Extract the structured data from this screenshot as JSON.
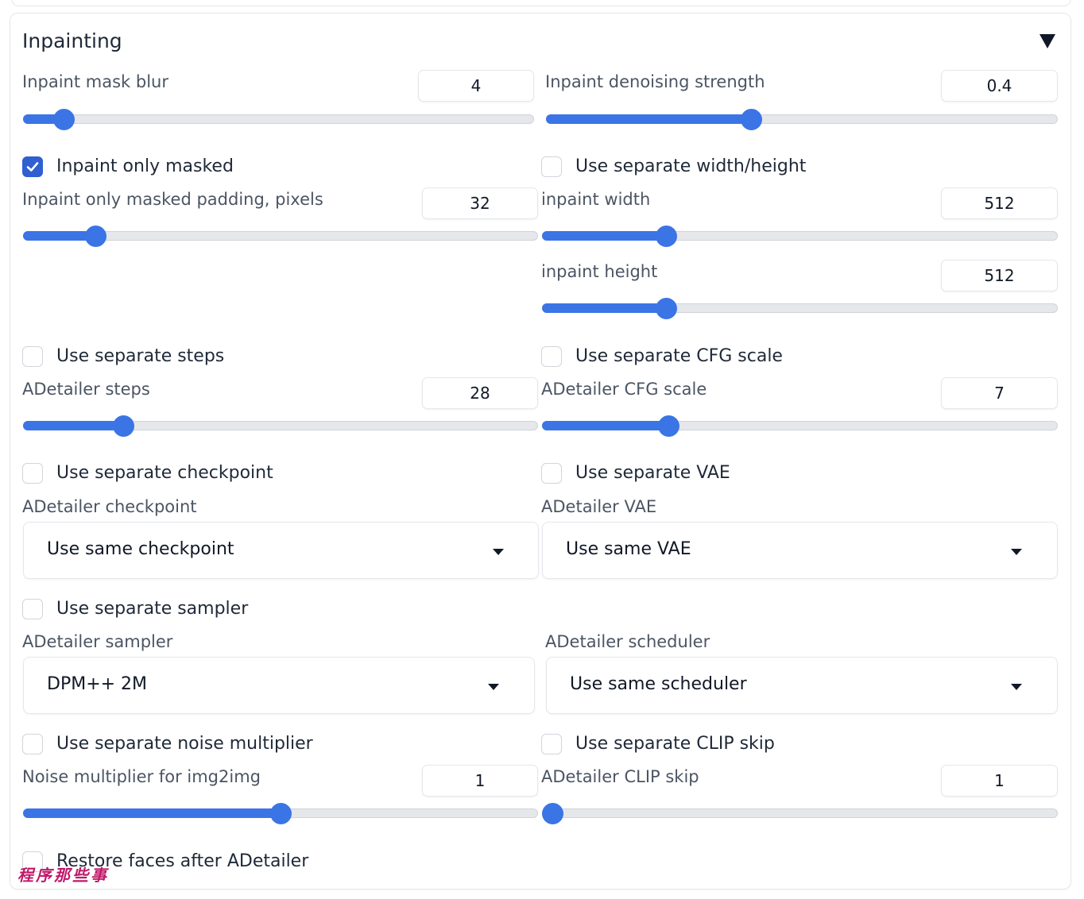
{
  "panel": {
    "title": "Inpainting"
  },
  "mask_blur": {
    "label": "Inpaint mask blur",
    "value": "4",
    "level": 0.08
  },
  "denoise": {
    "label": "Inpaint denoising strength",
    "value": "0.4",
    "level": 0.4
  },
  "only_masked": {
    "label": "Inpaint only masked",
    "checked": true
  },
  "sep_wh": {
    "label": "Use separate width/height",
    "checked": false
  },
  "padding": {
    "label": "Inpaint only masked padding, pixels",
    "value": "32",
    "level": 0.14
  },
  "width": {
    "label": "inpaint width",
    "value": "512",
    "level": 0.24
  },
  "height": {
    "label": "inpaint height",
    "value": "512",
    "level": 0.24
  },
  "sep_steps": {
    "label": "Use separate steps",
    "checked": false
  },
  "sep_cfg": {
    "label": "Use separate CFG scale",
    "checked": false
  },
  "steps": {
    "label": "ADetailer steps",
    "value": "28",
    "level": 0.195
  },
  "cfg": {
    "label": "ADetailer CFG scale",
    "value": "7",
    "level": 0.245
  },
  "sep_ckpt": {
    "label": "Use separate checkpoint",
    "checked": false
  },
  "sep_vae": {
    "label": "Use separate VAE",
    "checked": false
  },
  "ckpt": {
    "label": "ADetailer checkpoint",
    "value": "Use same checkpoint"
  },
  "vae": {
    "label": "ADetailer VAE",
    "value": "Use same VAE"
  },
  "sep_sampler": {
    "label": "Use separate sampler",
    "checked": false
  },
  "sampler": {
    "label": "ADetailer sampler",
    "value": "DPM++ 2M"
  },
  "scheduler": {
    "label": "ADetailer scheduler",
    "value": "Use same scheduler"
  },
  "sep_noise": {
    "label": "Use separate noise multiplier",
    "checked": false
  },
  "sep_clip": {
    "label": "Use separate CLIP skip",
    "checked": false
  },
  "noise": {
    "label": "Noise multiplier for img2img",
    "value": "1",
    "level": 0.5
  },
  "clip": {
    "label": "ADetailer CLIP skip",
    "value": "1",
    "level": 0.0
  },
  "restore": {
    "label": "Restore faces after ADetailer",
    "checked": false
  },
  "watermark": "程序那些事",
  "colors": {
    "accent": "#3b74e5",
    "checkbox_checked": "#2f5fd0",
    "watermark": "#c0186a"
  }
}
